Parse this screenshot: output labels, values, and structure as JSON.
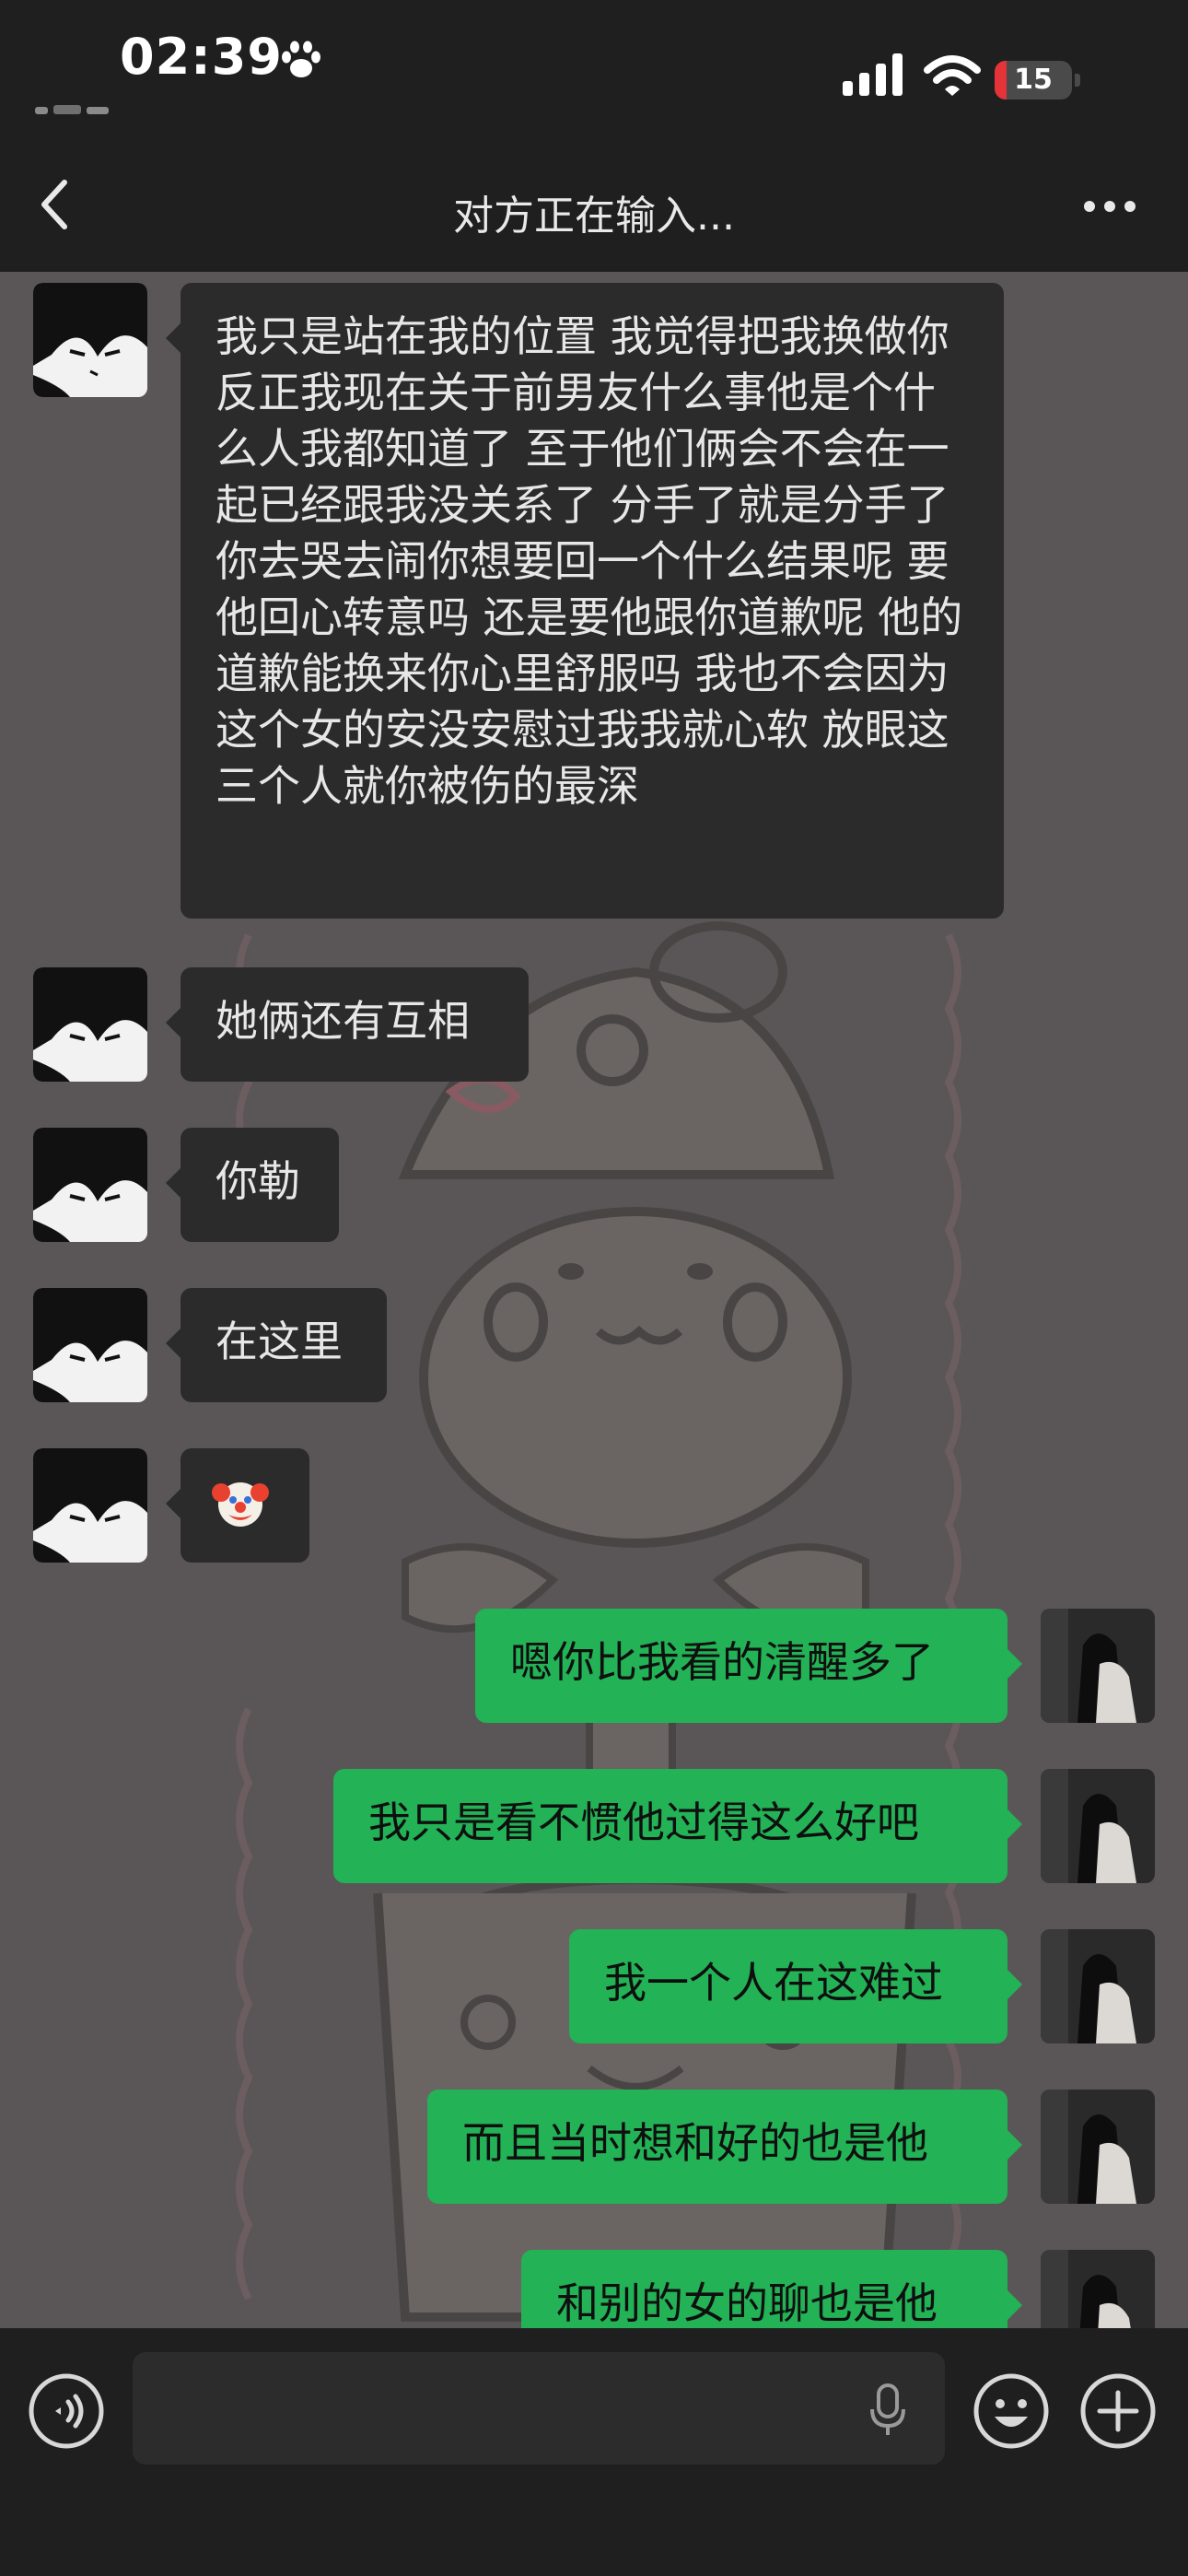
{
  "status_bar": {
    "time": "02:39",
    "battery": "15",
    "battery_level": 0.15,
    "icons": [
      "paw-icon",
      "signal-icon",
      "wifi-icon",
      "battery-icon"
    ]
  },
  "nav": {
    "title": "对方正在输入...",
    "back_icon": "chevron-left-icon",
    "more_icon": "more-dots-icon"
  },
  "messages": [
    {
      "side": "in",
      "text": "我只是站在我的位置 我觉得把我换做你 反正我现在关于前男友什么事他是个什么人我都知道了 至于他们俩会不会在一起已经跟我没关系了 分手了就是分手了 你去哭去闹你想要回一个什么结果呢 要他回心转意吗 还是要他跟你道歉呢 他的道歉能换来你心里舒服吗 我也不会因为这个女的安没安慰过我我就心软 放眼这三个人就你被伤的最深"
    },
    {
      "side": "in",
      "text": "她俩还有互相"
    },
    {
      "side": "in",
      "text": "你勒"
    },
    {
      "side": "in",
      "text": "在这里"
    },
    {
      "side": "in",
      "text": "",
      "emoji": "clown-face-icon"
    },
    {
      "side": "out",
      "text": "嗯你比我看的清醒多了"
    },
    {
      "side": "out",
      "text": "我只是看不惯他过得这么好吧"
    },
    {
      "side": "out",
      "text": "我一个人在这难过"
    },
    {
      "side": "out",
      "text": "而且当时想和好的也是他"
    },
    {
      "side": "out",
      "text": "和别的女的聊也是他"
    }
  ],
  "input_bar": {
    "value": "",
    "icons": [
      "voice-icon",
      "microphone-icon",
      "emoji-icon",
      "plus-icon"
    ]
  },
  "colors": {
    "background": "#1f1f1f",
    "chat_background": "#5a5658",
    "incoming_bubble": "#2b2b2b",
    "outgoing_bubble": "#23b256",
    "battery_low": "#e5333a"
  }
}
